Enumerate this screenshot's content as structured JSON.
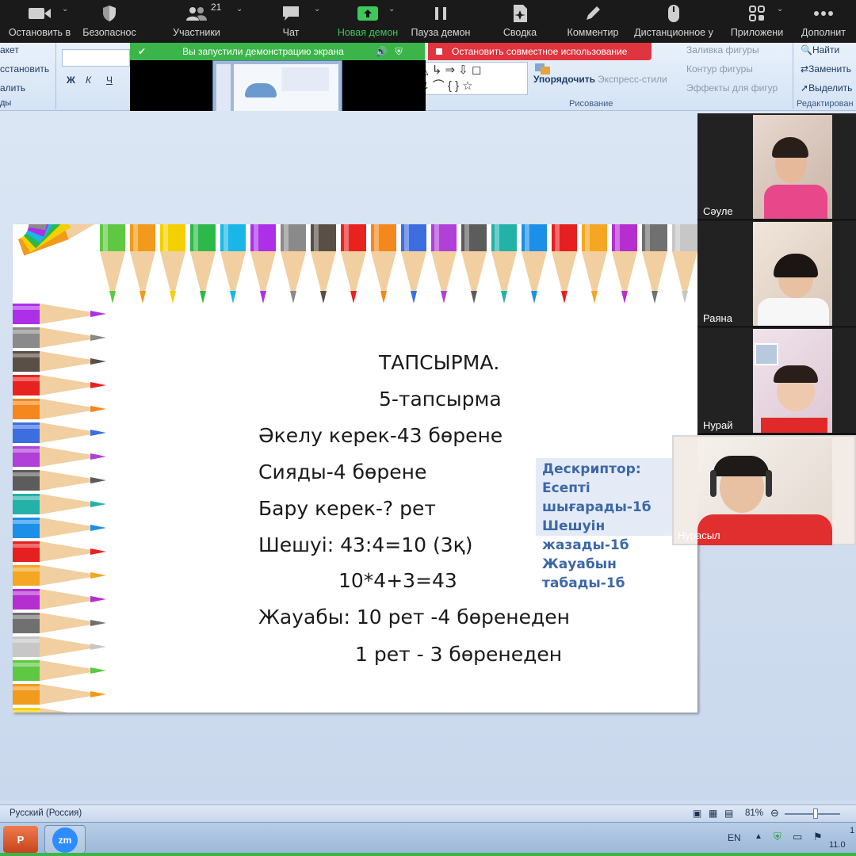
{
  "toolbar": {
    "items": [
      {
        "label": "Остановить в",
        "icon": "camera-icon"
      },
      {
        "label": "Безопаснос",
        "icon": "shield-icon"
      },
      {
        "label": "Участники",
        "icon": "participants-icon",
        "count": "21"
      },
      {
        "label": "Чат",
        "icon": "chat-icon"
      },
      {
        "label": "Новая демон",
        "icon": "share-screen-icon"
      },
      {
        "label": "Пауза демон",
        "icon": "pause-icon"
      },
      {
        "label": "Сводка",
        "icon": "summary-icon"
      },
      {
        "label": "Комментир",
        "icon": "annotate-icon"
      },
      {
        "label": "Дистанционное у",
        "icon": "remote-control-icon"
      },
      {
        "label": "Приложени",
        "icon": "apps-icon"
      },
      {
        "label": "Дополнит",
        "icon": "more-icon"
      }
    ]
  },
  "share_banner": {
    "sharing_text": "Вы запустили демонстрацию экрана",
    "stop_text": "Остановить совместное использование"
  },
  "ribbon": {
    "left_items": [
      "акет",
      "сстановить",
      "алить",
      "ды"
    ],
    "format_buttons": [
      "Ж",
      "К",
      "Ч"
    ],
    "arrange_label": "Упорядочить",
    "quick_styles_label": "Экспресс-стили",
    "shape_fill": "Заливка фигуры",
    "shape_outline": "Контур фигуры",
    "shape_effects": "Эффекты для фигур",
    "drawing_group": "Рисование",
    "find": "Найти",
    "replace": "Заменить",
    "select": "Выделить",
    "editing_group": "Редактирован"
  },
  "slide": {
    "lines": [
      "ТАПСЫРМА.",
      "5-тапсырма",
      "Әкелу керек-43 бөрене",
      "Сияды-4 бөрене",
      "Бару керек-? рет",
      "Шешуі: 43:4=10 (3қ)",
      "10*4+3=43",
      "Жауабы: 10 рет -4 бөренеден",
      "1 рет  - 3 бөренеден"
    ],
    "descriptor": {
      "title": "Дескриптор:",
      "items": [
        "Есепті шығарады-1б",
        "Шешуін жазады-1б",
        "Жауабын табады-1б"
      ]
    }
  },
  "participants": [
    {
      "name": "Сәуле"
    },
    {
      "name": "Раяна"
    },
    {
      "name": "Нурай"
    },
    {
      "name": "Нурасыл"
    }
  ],
  "status": {
    "language": "Русский (Россия)",
    "zoom": "81%",
    "input_lang": "EN",
    "clock_top": "1",
    "clock_bottom": "11.0"
  },
  "colors": {
    "zoom_bar": "#1a1a1a",
    "share_green": "#3bb54a",
    "share_red": "#e0343e",
    "descriptor_text": "#3d67a7",
    "descriptor_bg": "#e4ebf7"
  },
  "pencil_colors": [
    "#5ec843",
    "#f29a1b",
    "#f5d000",
    "#2db84a",
    "#19b6e8",
    "#ad2fe8",
    "#8a8a8a",
    "#5a4f47",
    "#e8231f",
    "#f4881c",
    "#3d6ee0",
    "#b040d8",
    "#5c5c5c",
    "#23b2a8",
    "#1c8fe8",
    "#e62020",
    "#f5a623",
    "#b42ed0",
    "#707070",
    "#c7c7c7"
  ]
}
